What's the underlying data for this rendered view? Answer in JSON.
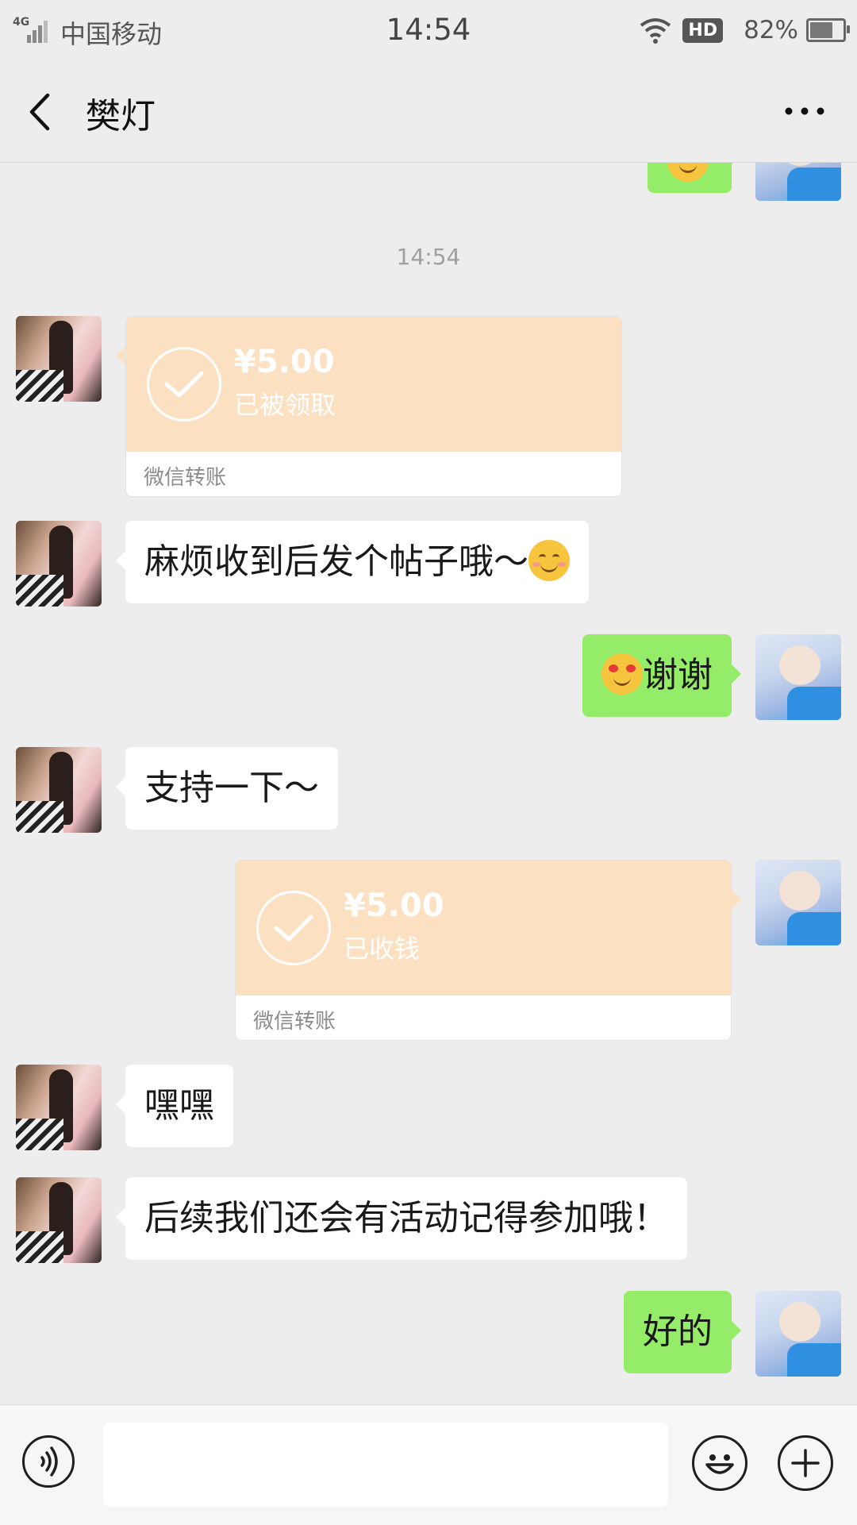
{
  "status_bar": {
    "network": "4G",
    "carrier": "中国移动",
    "time": "14:54",
    "hd": "HD",
    "battery": "82%"
  },
  "header": {
    "title": "樊灯",
    "back_icon": "chevron-left-icon",
    "more_icon": "more-dots-icon"
  },
  "chat": {
    "timestamp": "14:54",
    "transfer_received": {
      "amount": "¥5.00",
      "status": "已被领取",
      "label": "微信转账"
    },
    "msg_peer_1": "麻烦收到后发个帖子哦～",
    "msg_me_1": "谢谢",
    "msg_peer_2": "支持一下～",
    "transfer_sent": {
      "amount": "¥5.00",
      "status": "已收钱",
      "label": "微信转账"
    },
    "msg_peer_3": "嘿嘿",
    "msg_peer_4": "后续我们还会有活动记得参加哦！",
    "msg_me_2": "好的"
  },
  "input_bar": {
    "voice_icon": "voice-icon",
    "emoji_icon": "emoji-icon",
    "plus_icon": "plus-icon",
    "input_value": ""
  },
  "colors": {
    "background": "#ededed",
    "my_bubble": "#95ec69",
    "peer_bubble": "#ffffff",
    "transfer_card": "#fbe1c2"
  }
}
